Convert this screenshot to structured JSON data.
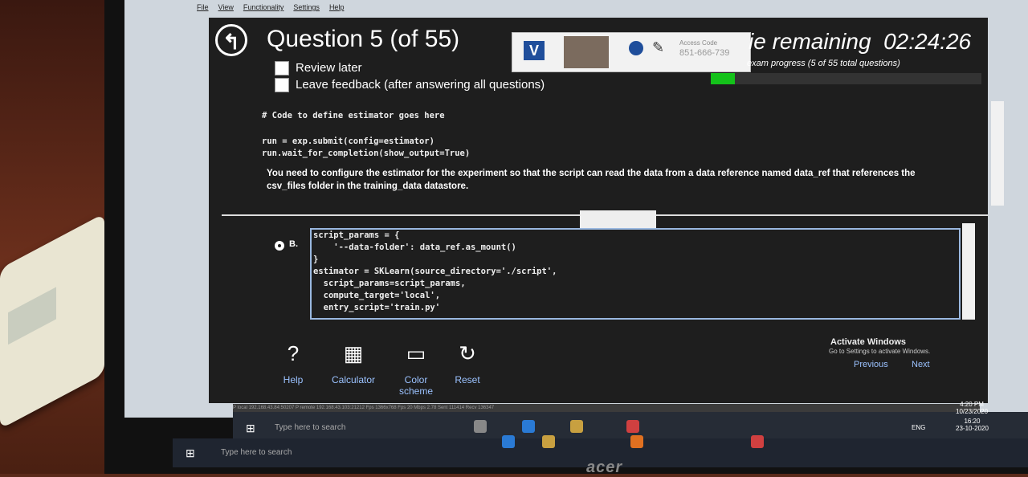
{
  "menu": [
    "File",
    "View",
    "Functionality",
    "Settings",
    "Help"
  ],
  "question": {
    "title": "Question 5 (of 55)",
    "review_later": "Review later",
    "leave_feedback": "Leave feedback (after answering all questions)"
  },
  "zoom": {
    "access_label": "Access Code",
    "access_code": "851-666-739",
    "chat": "Chat",
    "whiteboard": "Whiteboard"
  },
  "timer": {
    "label": "ie remaining",
    "value": "02:24:26",
    "progress_text": "exam progress (5 of 55 total questions)",
    "progress_fraction": 0.09
  },
  "code_top": [
    "# Code to define estimator goes here",
    "run = exp.submit(config=estimator)",
    "run.wait_for_completion(show_output=True)"
  ],
  "question_text": "You need to configure the estimator for the experiment so that the script can read the data from a data reference named data_ref that references the csv_files folder in the training_data datastore.",
  "option": {
    "label": "B.",
    "code": [
      "script_params = {",
      "    '--data-folder': data_ref.as_mount()",
      "}",
      "estimator = SKLearn(source_directory='./script',",
      "  script_params=script_params,",
      "  compute_target='local',",
      "  entry_script='train.py'"
    ]
  },
  "tools": [
    {
      "icon": "?",
      "label": "Help"
    },
    {
      "icon": "▦",
      "label": "Calculator"
    },
    {
      "icon": "▭",
      "label": "Color scheme"
    },
    {
      "icon": "↻",
      "label": "Reset"
    }
  ],
  "activate": {
    "title": "Activate Windows",
    "sub": "Go to Settings to activate Windows."
  },
  "nav": {
    "previous": "Previous",
    "next": "Next"
  },
  "status": "P local 192.168.43.84:50207     P remote 192.168.43.103:21212     Fps 1366x768     Fps 20     Mbps 2.78     Sent 111414     Recv 136347",
  "taskbar_inner": {
    "search": "Type here to search",
    "time": "4:20 PM",
    "date": "10/23/2020"
  },
  "taskbar_outer": {
    "search": "Type here to search",
    "time": "16:20",
    "date": "23-10-2020",
    "lang": "ENG"
  },
  "brand": "acer"
}
